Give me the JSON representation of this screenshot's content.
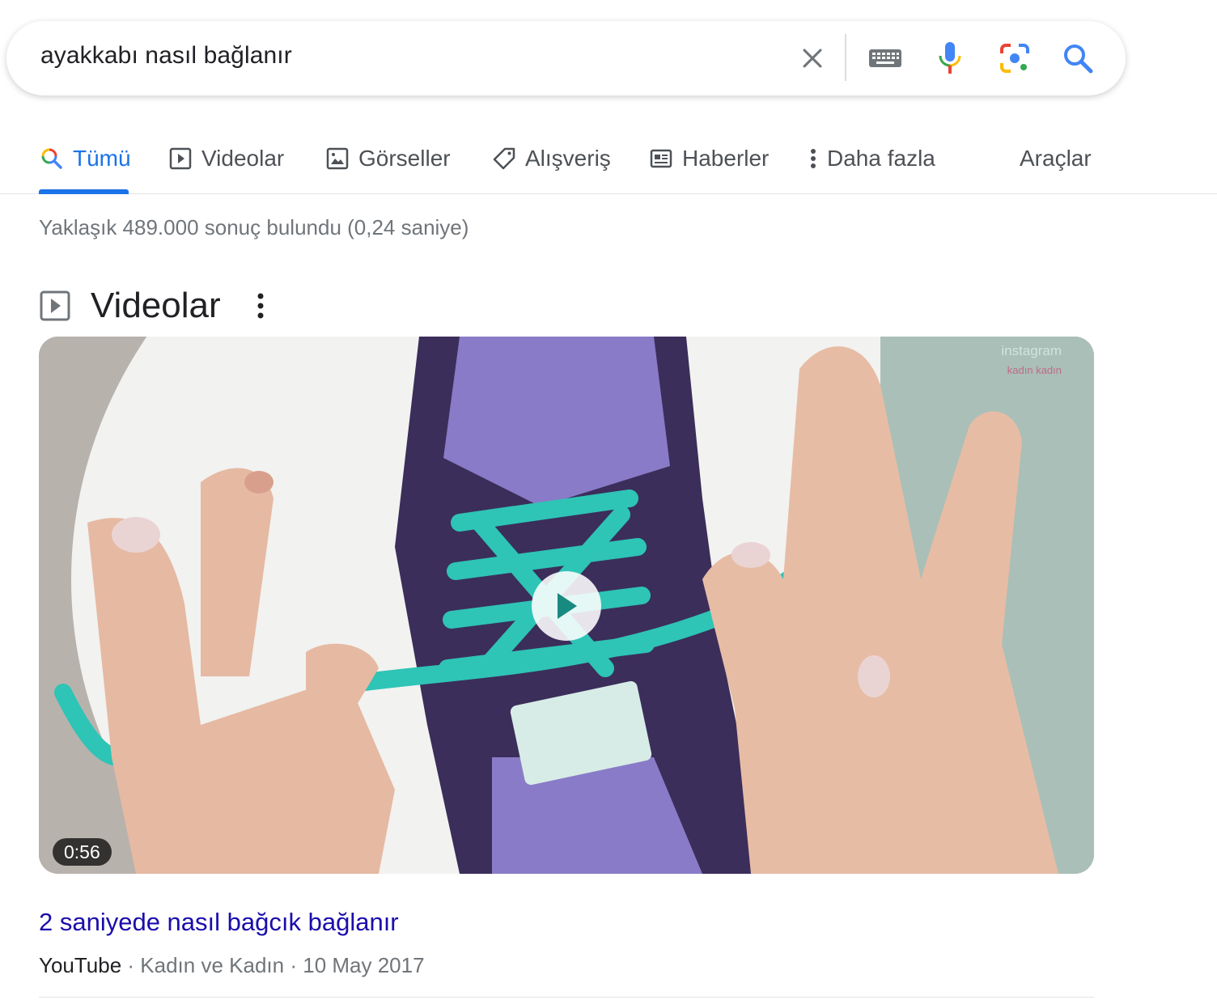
{
  "search": {
    "query": "ayakkabı nasıl bağlanır"
  },
  "tabs": [
    {
      "label": "Tümü",
      "icon": "search-icon",
      "active": true
    },
    {
      "label": "Videolar",
      "icon": "video-icon"
    },
    {
      "label": "Görseller",
      "icon": "image-icon"
    },
    {
      "label": "Alışveriş",
      "icon": "tag-icon"
    },
    {
      "label": "Haberler",
      "icon": "news-icon"
    },
    {
      "label": "Daha fazla",
      "icon": "more-vert-icon"
    }
  ],
  "tools_label": "Araçlar",
  "result_stats": "Yaklaşık 489.000 sonuç bulundu (0,24 saniye)",
  "videos_section": {
    "title": "Videolar",
    "video": {
      "duration": "0:56",
      "watermark_line1": "instagram",
      "watermark_line2": "kadın kadın",
      "title": "2 saniyede nasıl bağcık bağlanır",
      "source": "YouTube",
      "channel": "Kadın ve Kadın",
      "date": "10 May 2017"
    }
  },
  "colors": {
    "link": "#1a0dab",
    "accent": "#1a73e8",
    "lace": "#2ec4b6",
    "shoe": "#8a7bc8"
  }
}
